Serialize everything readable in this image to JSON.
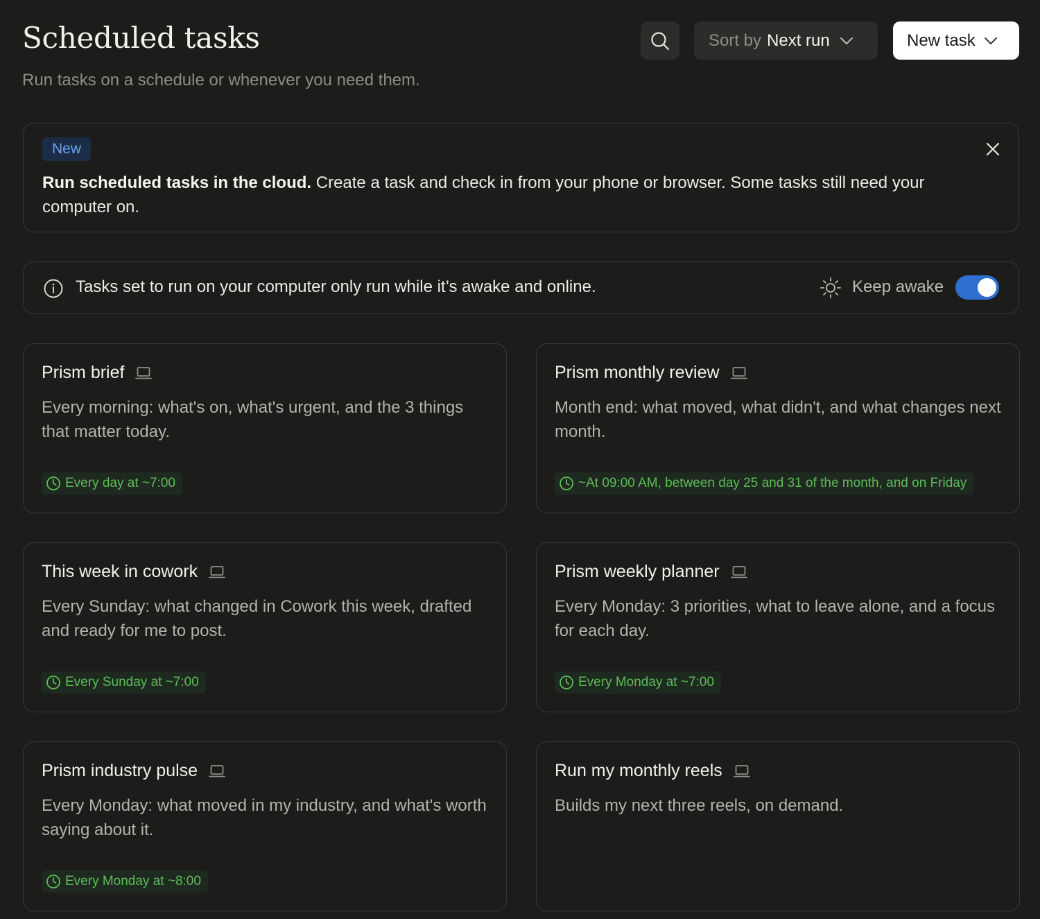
{
  "header": {
    "title": "Scheduled tasks",
    "subtitle": "Run tasks on a schedule or whenever you need them.",
    "sort_prefix": "Sort by",
    "sort_value": "Next run",
    "new_task_label": "New task"
  },
  "banner": {
    "badge": "New",
    "headline": "Run scheduled tasks in the cloud.",
    "body": " Create a task and check in from your phone or browser. Some tasks still need your computer on."
  },
  "infobar": {
    "message": "Tasks set to run on your computer only run while it’s awake and online.",
    "keep_awake_label": "Keep awake",
    "keep_awake_on": true
  },
  "tasks": [
    {
      "title": "Prism brief",
      "description": "Every morning: what's on, what's urgent, and the 3 things that matter today.",
      "schedule": "Every day at ~7:00"
    },
    {
      "title": "Prism monthly review",
      "description": "Month end: what moved, what didn't, and what changes next month.",
      "schedule": "~At 09:00 AM, between day 25 and 31 of the month, and on Friday"
    },
    {
      "title": "This week in cowork",
      "description": "Every Sunday: what changed in Cowork this week, drafted and ready for me to post.",
      "schedule": "Every Sunday at ~7:00"
    },
    {
      "title": "Prism weekly planner",
      "description": "Every Monday: 3 priorities, what to leave alone, and a focus for each day.",
      "schedule": "Every Monday at ~7:00"
    },
    {
      "title": "Prism industry pulse",
      "description": "Every Monday: what moved in my industry, and what's worth saying about it.",
      "schedule": "Every Monday at ~8:00"
    },
    {
      "title": "Run my monthly reels",
      "description": "Builds my next three reels, on demand.",
      "schedule": ""
    }
  ],
  "colors": {
    "background": "#1c1c1b",
    "accent_blue": "#2f6fd0",
    "schedule_green": "#5fba5a",
    "badge_blue": "#6aa3ee"
  },
  "icons": [
    "search-icon",
    "chevron-down-icon",
    "close-icon",
    "info-icon",
    "sun-icon",
    "laptop-icon",
    "clock-icon"
  ]
}
